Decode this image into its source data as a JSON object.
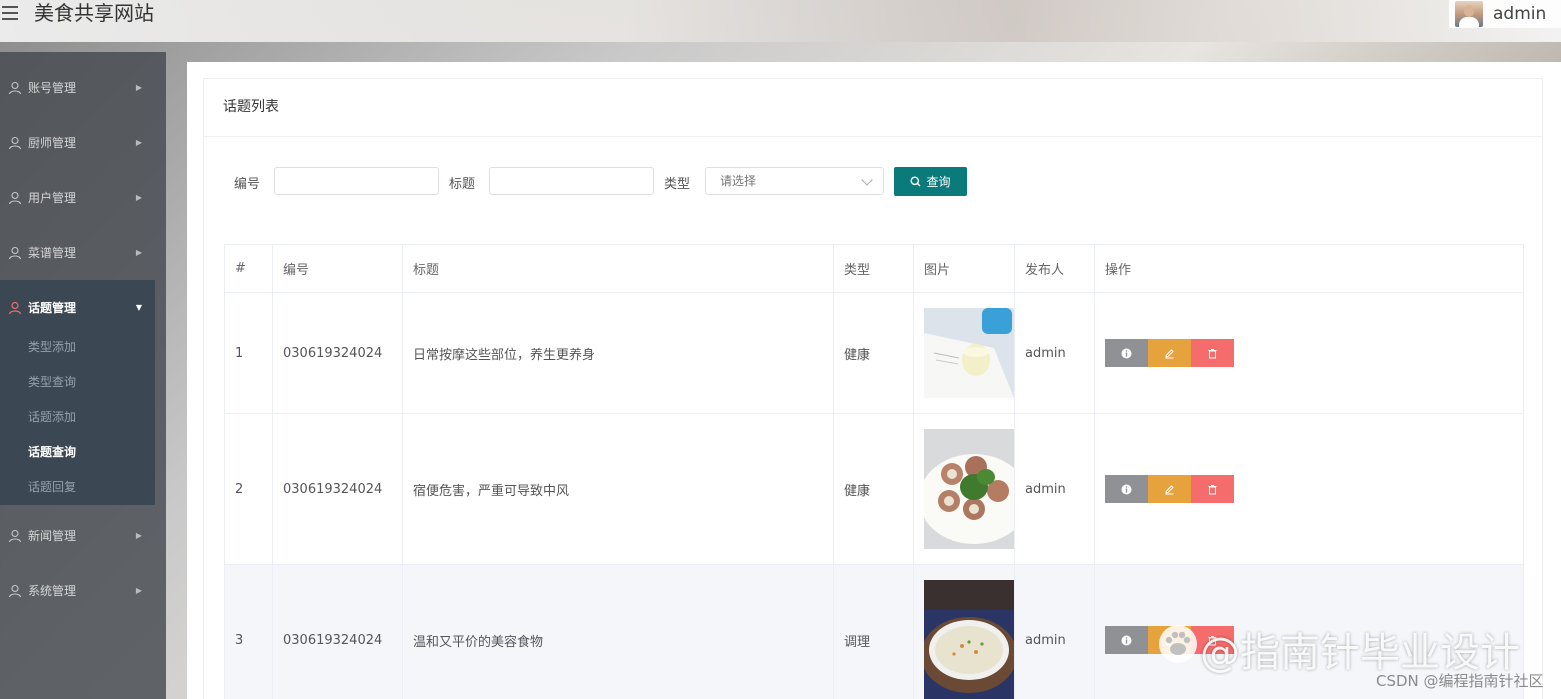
{
  "header": {
    "title": "美食共享网站",
    "user": "admin"
  },
  "sidebar": {
    "items": [
      {
        "label": "账号管理"
      },
      {
        "label": "厨师管理"
      },
      {
        "label": "用户管理"
      },
      {
        "label": "菜谱管理"
      },
      {
        "label": "话题管理"
      },
      {
        "label": "新闻管理"
      },
      {
        "label": "系统管理"
      }
    ],
    "submenu": [
      {
        "label": "类型添加"
      },
      {
        "label": "类型查询"
      },
      {
        "label": "话题添加"
      },
      {
        "label": "话题查询"
      },
      {
        "label": "话题回复"
      }
    ]
  },
  "panel": {
    "title": "话题列表"
  },
  "search": {
    "id_label": "编号",
    "title_label": "标题",
    "type_label": "类型",
    "type_placeholder": "请选择",
    "query_button": "查询"
  },
  "table": {
    "headers": [
      "#",
      "编号",
      "标题",
      "类型",
      "图片",
      "发布人",
      "操作"
    ],
    "rows": [
      {
        "index": "1",
        "id": "030619324024",
        "title": "日常按摩这些部位，养生更养身",
        "type": "健康",
        "publisher": "admin"
      },
      {
        "index": "2",
        "id": "030619324024",
        "title": "宿便危害，严重可导致中风",
        "type": "健康",
        "publisher": "admin"
      },
      {
        "index": "3",
        "id": "030619324024",
        "title": "温和又平价的美容食物",
        "type": "调理",
        "publisher": "admin"
      }
    ]
  },
  "watermark": {
    "main": "@指南针毕业设计",
    "sub": "CSDN @编程指南针社区"
  },
  "colors": {
    "primary": "#0b7a7a",
    "info": "#8f9194",
    "edit": "#e6a23c",
    "delete": "#f56c6c",
    "sidebar_active": "#3b4753"
  }
}
